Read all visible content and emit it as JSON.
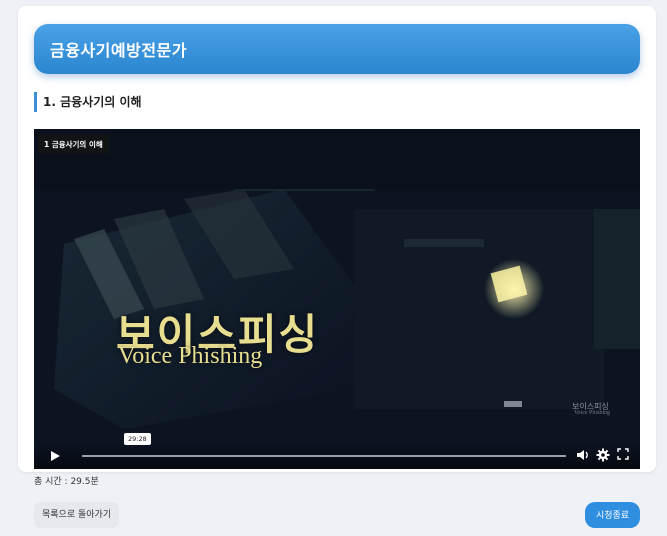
{
  "header": {
    "title": "금융사기예방전문가"
  },
  "section": {
    "title": "1. 금융사기의 이해"
  },
  "video": {
    "label": "1 금융사기의 이해",
    "overlay_ko": "보이스피싱",
    "overlay_en": "Voice Phishing",
    "watermark_ko": "보이스피싱",
    "watermark_en": "Voice Phishing",
    "hover_time": "29:28",
    "progress": 0.0,
    "icons": [
      "play-icon",
      "volume-icon",
      "gear-icon",
      "fullscreen-icon"
    ]
  },
  "footer": {
    "total_time": "총 시간 : 29.5분",
    "back_label": "목록으로 돌아가기",
    "end_label": "시청종료"
  },
  "colors": {
    "accent": "#2f8ee0",
    "header_gradient_top": "#4aa1e6",
    "header_gradient_bottom": "#2b86d0",
    "overlay_text": "#e8de90"
  }
}
